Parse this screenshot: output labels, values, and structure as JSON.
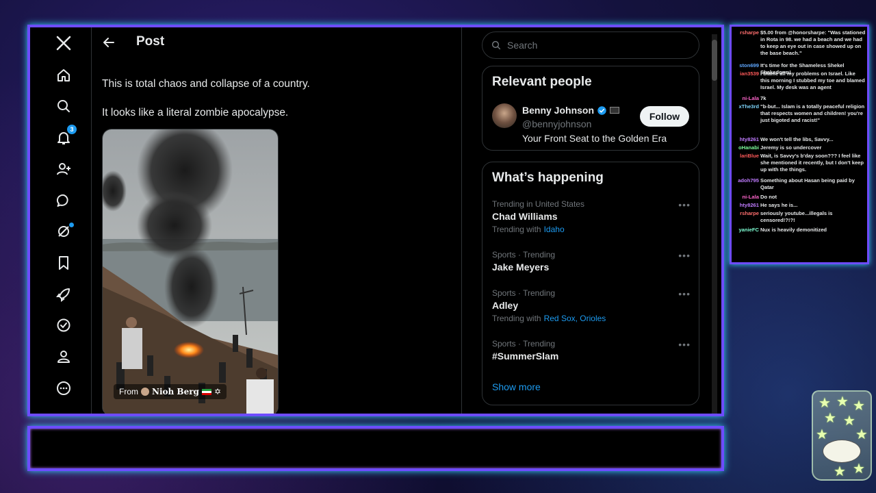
{
  "nav": {
    "logo_icon": "x-logo-icon",
    "notifications_badge": "3"
  },
  "post": {
    "header_title": "Post",
    "line1": "This is total chaos and collapse of a country.",
    "line2": "It looks like a literal zombie apocalypse.",
    "media_caption_from": "From",
    "media_caption_author": "Nioh Berg"
  },
  "search": {
    "placeholder": "Search"
  },
  "relevant_people": {
    "title": "Relevant people",
    "name": "Benny Johnson",
    "handle": "@bennyjohnson",
    "bio": "Your Front Seat to the Golden Era",
    "follow_label": "Follow"
  },
  "happening": {
    "title": "What’s happening",
    "trends": [
      {
        "meta": "Trending in United States",
        "name": "Chad Williams",
        "with_label": "Trending with",
        "with_links": "Idaho"
      },
      {
        "meta": "Sports · Trending",
        "name": "Jake Meyers",
        "with_label": "",
        "with_links": ""
      },
      {
        "meta": "Sports · Trending",
        "name": "Adley",
        "with_label": "Trending with",
        "with_links": "Red Sox, Orioles"
      },
      {
        "meta": "Sports · Trending",
        "name": "#SummerSlam",
        "with_label": "",
        "with_links": ""
      }
    ],
    "show_more": "Show more"
  },
  "chat": [
    {
      "user": "rsharpe",
      "color": "#ff6f6f",
      "text": "$5.00 from @honorsharpe: \"Was stationed in Rota in 98. we had a beach and we had to keep an eye out in case showed up on the base beach.\""
    },
    {
      "user": "ston699",
      "color": "#5fa8ff",
      "text": "It's time for the Shameless Shekel Shakedown!"
    },
    {
      "user": "ian3539",
      "color": "#ff5a5a",
      "text": "I blame all my problems on Israel. Like this morning I stubbed my toe and blamed Israel. My desk was an agent"
    },
    {
      "user": "ni-Lala",
      "color": "#ff66cc",
      "text": "7k"
    },
    {
      "user": "xThe3rd",
      "color": "#7fd7ff",
      "text": "\"b-but... Islam is a totally peaceful religion that respects women and children! you're just bigoted and racist!\""
    },
    {
      "user": "hty8261",
      "color": "#c07cff",
      "text": "We won't tell the libs, Savvy..."
    },
    {
      "user": "oHanabi",
      "color": "#7fff9e",
      "text": "Jeremy is so undercover"
    },
    {
      "user": "lariBlue",
      "color": "#ff5a5a",
      "text": "Wait, is Savvy's b'day soon??? I feel like she mentioned it recently, but I don't keep up with the things."
    },
    {
      "user": "adoh795",
      "color": "#c07cff",
      "text": "Something about Hasan being paid by Qatar"
    },
    {
      "user": "ni-Lala",
      "color": "#ff66cc",
      "text": "Do not"
    },
    {
      "user": "hty8261",
      "color": "#c07cff",
      "text": "He says he is..."
    },
    {
      "user": "rsharpe",
      "color": "#ff6f6f",
      "text": "seriously youtube...illegals is censored!?!?!"
    },
    {
      "user": "yanieFC",
      "color": "#7fffd4",
      "text": "Nux is heavily demonitized"
    }
  ],
  "colors": {
    "accent": "#1d9bf0",
    "frame": "#6e4cff",
    "frame_glow": "#39d0ff"
  }
}
